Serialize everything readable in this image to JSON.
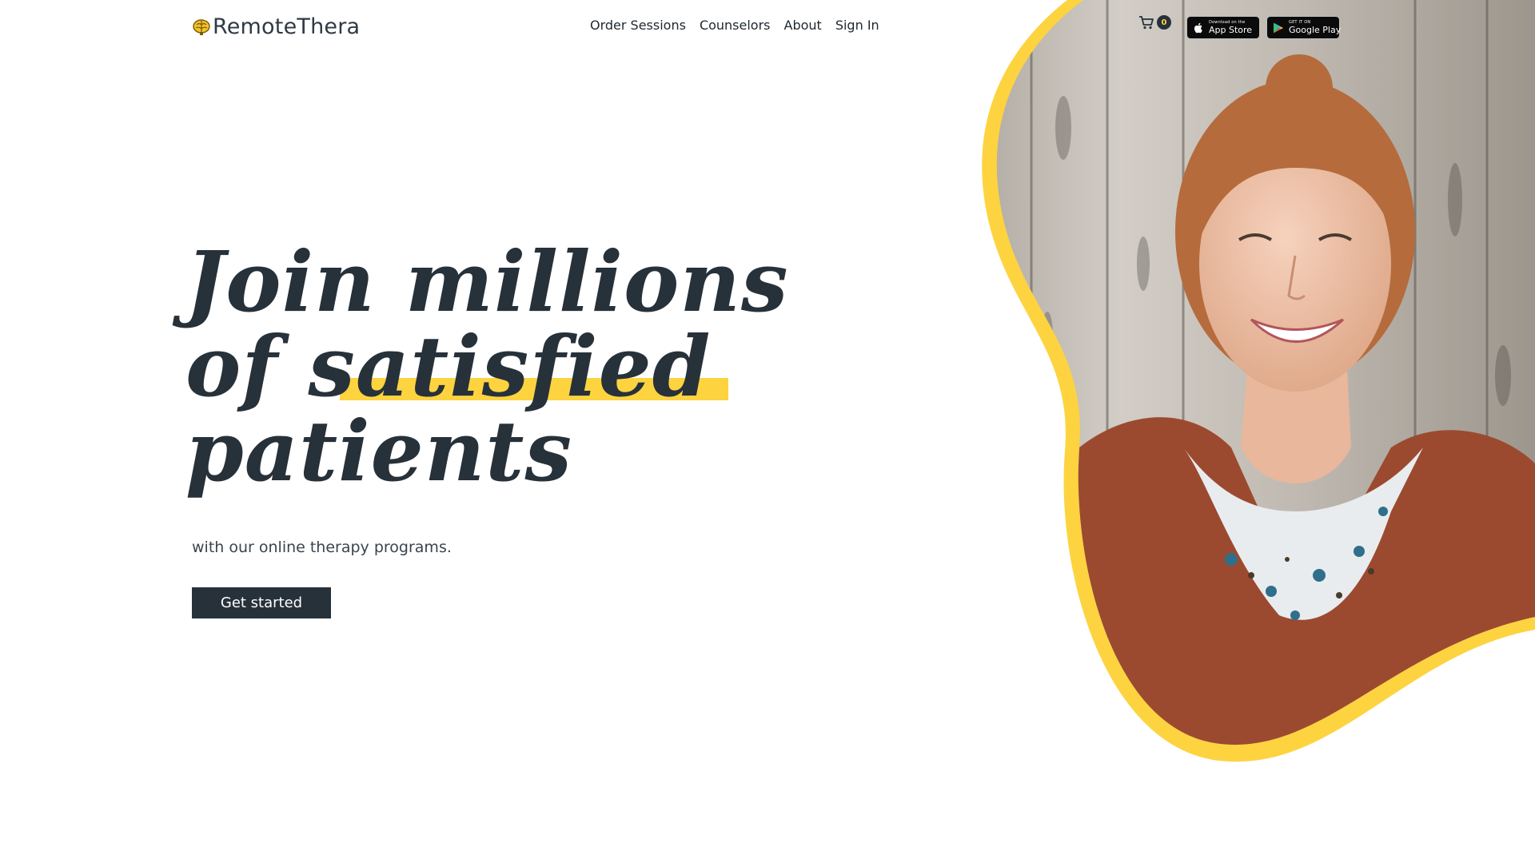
{
  "brand": {
    "name": "RemoteThera",
    "logo_icon": "brain-icon"
  },
  "nav": {
    "items": [
      {
        "label": "Order Sessions"
      },
      {
        "label": "Counselors"
      },
      {
        "label": "About"
      },
      {
        "label": "Sign In"
      }
    ]
  },
  "cart": {
    "icon": "cart-icon",
    "count": "0"
  },
  "store_badges": {
    "apple": {
      "small": "Download on the",
      "big": "App Store",
      "icon": "apple-icon"
    },
    "google": {
      "small": "GET IT ON",
      "big": "Google Play",
      "icon": "play-icon"
    }
  },
  "hero": {
    "line1": "Join millions",
    "line2_prefix": "of ",
    "line2_highlight": "satisfied",
    "line3": "patients",
    "subtext": "with our online therapy programs.",
    "cta_label": "Get started"
  },
  "colors": {
    "accent": "#fdd340",
    "dark": "#27313a",
    "background": "#ffffff"
  }
}
